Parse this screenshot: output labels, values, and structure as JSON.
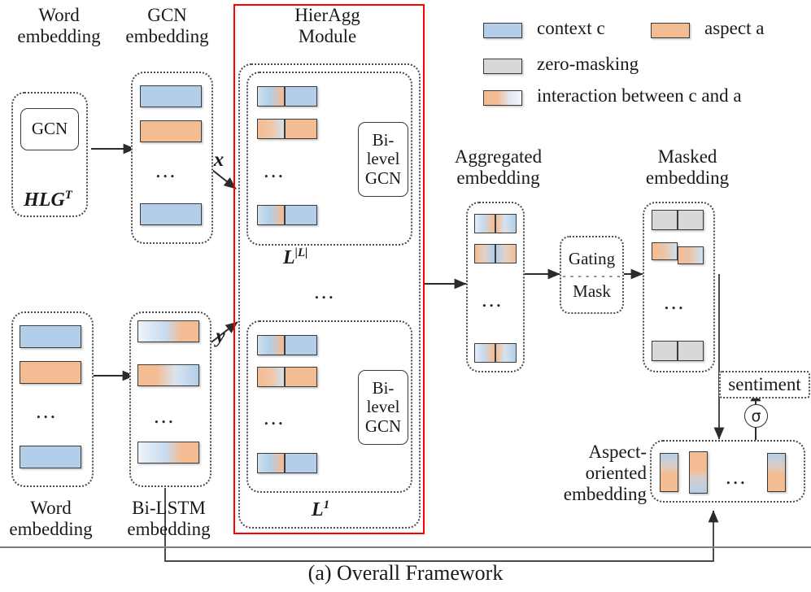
{
  "figure": {
    "caption": "(a) Overall Framework",
    "highlight_color": "#ff0000",
    "colors": {
      "context_blue": "#b3cee8",
      "aspect_orange": "#f4bc93",
      "zero_mask_gray": "#d8d8d8"
    }
  },
  "legend": {
    "items": [
      {
        "label": "context c",
        "swatch": "blue",
        "name": "legend-context"
      },
      {
        "label": "aspect a",
        "swatch": "orange",
        "name": "legend-aspect"
      },
      {
        "label": "zero-masking",
        "swatch": "gray",
        "name": "legend-zero-masking"
      },
      {
        "label": "interaction between c and a",
        "swatch": "grad-orange-blue",
        "name": "legend-interaction"
      }
    ]
  },
  "columns": {
    "word_embedding_top": {
      "title": "Word\nembedding",
      "line1": "Word",
      "line2": "embedding"
    },
    "gcn_embedding": {
      "title": "GCN\nembedding",
      "line1": "GCN",
      "line2": "embedding"
    },
    "word_embedding_bottom": {
      "line1": "Word",
      "line2": "embedding"
    },
    "bilstm_embedding": {
      "line1": "Bi-LSTM",
      "line2": "embedding"
    },
    "aggregated_embedding": {
      "line1": "Aggregated",
      "line2": "embedding"
    },
    "masked_embedding": {
      "line1": "Masked",
      "line2": "embedding"
    },
    "aspect_oriented_embedding": {
      "line1": "Aspect-",
      "line2": "oriented",
      "line3": "embedding"
    }
  },
  "blocks": {
    "gcn": {
      "label": "GCN"
    },
    "hlg_input": {
      "label": "HLG",
      "sup": "T"
    },
    "hieragg": {
      "line1": "HierAgg",
      "line2": "Module"
    },
    "bilevel_gcn_top": {
      "line1": "Bi-level",
      "line2": "GCN"
    },
    "bilevel_gcn_bottom": {
      "line1": "Bi-level",
      "line2": "GCN"
    },
    "gating_mask": {
      "line1": "Gating",
      "divider": "- - - - - - - -",
      "line2": "Mask"
    },
    "sentiment": {
      "label": "sentiment"
    },
    "sigma": {
      "label": "σ"
    }
  },
  "edge_labels": {
    "x": "x",
    "y": "y",
    "layer_top": "L",
    "layer_top_sup": "|L|",
    "layer_bottom": "L",
    "layer_bottom_sup": "1",
    "ellipsis": "..."
  },
  "gcn_embedding_bars": [
    {
      "type": "solid-blue"
    },
    {
      "type": "solid-orange"
    },
    {
      "type": "ellipsis"
    },
    {
      "type": "solid-blue"
    }
  ],
  "word_embedding_bars": [
    {
      "type": "solid-blue"
    },
    {
      "type": "solid-orange"
    },
    {
      "type": "ellipsis"
    },
    {
      "type": "solid-blue"
    }
  ],
  "bilstm_bars": [
    {
      "type": "grad-blue-orange"
    },
    {
      "type": "grad-orange-blue"
    },
    {
      "type": "ellipsis"
    },
    {
      "type": "grad-blue-orange"
    }
  ],
  "hieragg_top_bars": [
    {
      "left": "grad-blue-orange",
      "right": "blue"
    },
    {
      "left": "grad-orange-blue",
      "right": "orange"
    },
    {
      "type": "ellipsis"
    },
    {
      "left": "grad-blue-orange",
      "right": "blue"
    }
  ],
  "hieragg_bottom_bars": [
    {
      "left": "grad-blue-orange",
      "right": "blue"
    },
    {
      "left": "grad-orange-blue",
      "right": "orange"
    },
    {
      "type": "ellipsis"
    },
    {
      "left": "grad-blue-orange",
      "right": "blue"
    }
  ],
  "aggregated_bars": [
    {
      "left": "grad-blue-orange",
      "right": "grad-orange-blue"
    },
    {
      "left": "grad-orange-blue",
      "right": "grad-blue-orange"
    },
    {
      "type": "ellipsis"
    },
    {
      "left": "grad-blue-orange",
      "right": "grad-orange-blue"
    }
  ],
  "masked_bars": [
    {
      "left": "gray",
      "right": "gray"
    },
    {
      "left": "grad-orange-blue",
      "right": "grad-orange-blue"
    },
    {
      "type": "ellipsis"
    },
    {
      "left": "gray",
      "right": "gray"
    }
  ],
  "aspect_oriented_bars": [
    {
      "type": "vgrad-blue-orange"
    },
    {
      "type": "vgrad-orange-blue-bottom"
    },
    {
      "type": "ellipsis"
    },
    {
      "type": "vgrad-blue-orange"
    }
  ]
}
